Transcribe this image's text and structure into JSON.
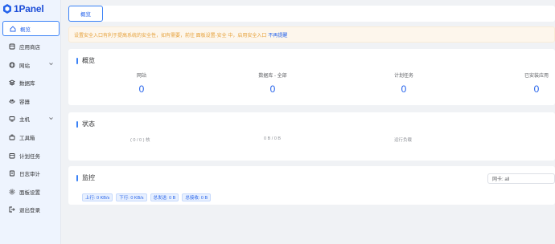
{
  "app": {
    "name": "1Panel"
  },
  "sidebar": {
    "items": [
      {
        "label": "概览",
        "icon": "home-icon",
        "active": true,
        "chevron": false
      },
      {
        "label": "应用商店",
        "icon": "appstore-icon",
        "active": false,
        "chevron": false
      },
      {
        "label": "网站",
        "icon": "globe-icon",
        "active": false,
        "chevron": true
      },
      {
        "label": "数据库",
        "icon": "database-icon",
        "active": false,
        "chevron": false
      },
      {
        "label": "容器",
        "icon": "container-icon",
        "active": false,
        "chevron": false
      },
      {
        "label": "主机",
        "icon": "host-icon",
        "active": false,
        "chevron": true
      },
      {
        "label": "工具箱",
        "icon": "toolbox-icon",
        "active": false,
        "chevron": false
      },
      {
        "label": "计划任务",
        "icon": "calendar-icon",
        "active": false,
        "chevron": false
      },
      {
        "label": "日志审计",
        "icon": "log-icon",
        "active": false,
        "chevron": false
      },
      {
        "label": "面板设置",
        "icon": "settings-icon",
        "active": false,
        "chevron": false
      },
      {
        "label": "退出登录",
        "icon": "logout-icon",
        "active": false,
        "chevron": false
      }
    ]
  },
  "topbar": {
    "tab_label": "概览"
  },
  "alert": {
    "text": "设置安全入口有利于提高系统的安全性，如有需要，前往 面板设置-安全 中，启用安全入口",
    "link": "不再提醒"
  },
  "overview": {
    "title": "概览",
    "stats": [
      {
        "label": "网站",
        "value": "0"
      },
      {
        "label": "数据库 - 全部",
        "value": "0"
      },
      {
        "label": "计划任务",
        "value": "0"
      },
      {
        "label": "已安装应用",
        "value": "0"
      }
    ]
  },
  "status": {
    "title": "状态",
    "items": [
      "( 0 / 0 ) 核",
      "0 B / 0 B",
      "运行负载"
    ]
  },
  "monitor": {
    "title": "监控",
    "select_value": "网卡: all",
    "tags": [
      "上行: 0 KB/s",
      "下行: 0 KB/s",
      "总发送: 0 B",
      "总接收: 0 B"
    ]
  },
  "colors": {
    "accent": "#2563eb",
    "sidebar_bg": "#eef4fe",
    "alert_text": "#e6a23c"
  }
}
